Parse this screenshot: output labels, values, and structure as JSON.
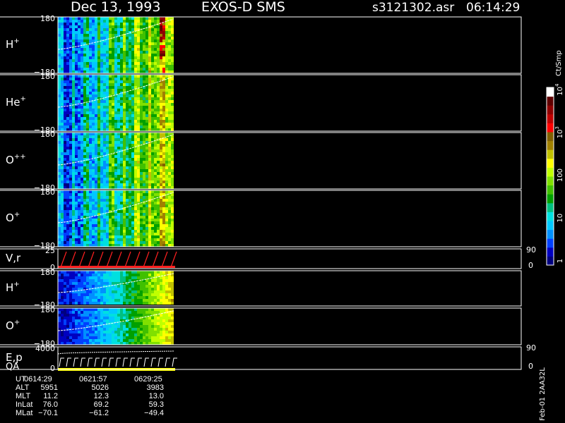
{
  "header": {
    "date": "Dec 13, 1993",
    "instrument": "EXOS-D SMS",
    "filename": "s3121302.asr",
    "time": "06:14:29"
  },
  "colorbar": {
    "unit": "Ct/Smp",
    "ticks": [
      {
        "label": "1",
        "sup": "",
        "value": 1
      },
      {
        "label": "10",
        "sup": "",
        "value": 10
      },
      {
        "label": "100",
        "sup": "",
        "value": 100
      },
      {
        "label": "10",
        "sup": "3",
        "value": 1000
      },
      {
        "label": "10",
        "sup": "4",
        "value": 10000
      }
    ],
    "colors": [
      "#000080",
      "#0000c0",
      "#0040ff",
      "#0090ff",
      "#00c8ff",
      "#00e0e0",
      "#00c080",
      "#00a000",
      "#40c000",
      "#80e000",
      "#c0ff00",
      "#ffff00",
      "#c0c000",
      "#a08000",
      "#806000",
      "#ff0000",
      "#c00000",
      "#900000",
      "#600000",
      "#ffffff"
    ]
  },
  "chart_data": {
    "type": "heatmap",
    "panels": [
      {
        "id": "h_plus_1",
        "label": "H",
        "sup": "+",
        "ymax": "180",
        "ymin": "−180",
        "colorscale": "linear"
      },
      {
        "id": "he_plus",
        "label": "He",
        "sup": "+",
        "ymax": "180",
        "ymin": "−180",
        "colorscale": "linear"
      },
      {
        "id": "o_plusplus",
        "label": "O",
        "sup": "++",
        "ymax": "180",
        "ymin": "−180",
        "colorscale": "linear"
      },
      {
        "id": "o_plus_1",
        "label": "O",
        "sup": "+",
        "ymax": "180",
        "ymin": "−180",
        "colorscale": "linear"
      },
      {
        "id": "vr",
        "label": "V,r",
        "sup": "",
        "ymax": "25",
        "ymin": "0",
        "right_top": "90",
        "right_bottom": "0",
        "kind": "sawtooth"
      },
      {
        "id": "h_plus_2",
        "label": "H",
        "sup": "+",
        "ymax": "180",
        "ymin": "−180",
        "colorscale": "linear"
      },
      {
        "id": "o_plus_2",
        "label": "O",
        "sup": "+",
        "ymax": "180",
        "ymin": "−180",
        "colorscale": "linear"
      },
      {
        "id": "ep",
        "label": "E,p",
        "sup": "",
        "ymax": "4000",
        "ymin": "0",
        "right_top": "90",
        "right_bottom": "0",
        "kind": "step",
        "qa_label": "QA"
      }
    ],
    "side_label": "Feb-01 2AA32L"
  },
  "ephemeris": {
    "rows": [
      {
        "label": "UT",
        "values": [
          "0614:29",
          "0621:57",
          "0629:25"
        ]
      },
      {
        "label": "ALT",
        "values": [
          "5951",
          "5026",
          "3983"
        ]
      },
      {
        "label": "MLT",
        "values": [
          "11.2",
          "12.3",
          "13.0"
        ]
      },
      {
        "label": "InLat",
        "values": [
          "76.0",
          "69.2",
          "59.3"
        ]
      },
      {
        "label": "MLat",
        "values": [
          "−70.1",
          "−61.2",
          "−49.4"
        ]
      }
    ]
  }
}
